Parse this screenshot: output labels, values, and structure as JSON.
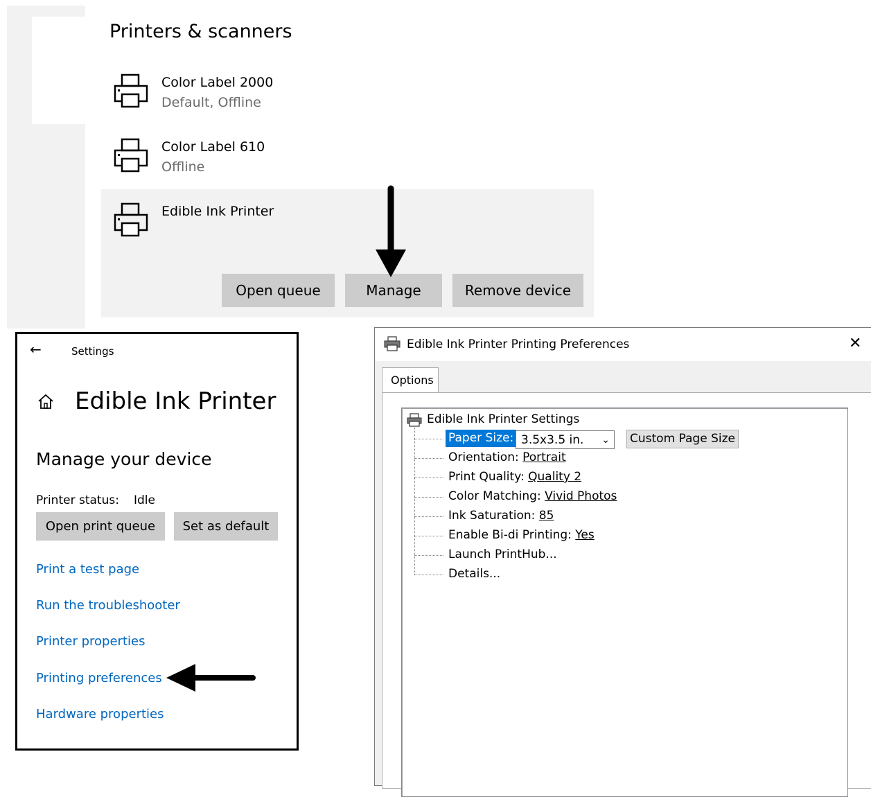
{
  "printers_panel": {
    "title": "Printers & scanners",
    "printers": [
      {
        "name": "Color Label 2000",
        "status": "Default, Offline"
      },
      {
        "name": "Color Label 610",
        "status": "Offline"
      },
      {
        "name": "Edible Ink Printer",
        "status": ""
      }
    ],
    "buttons": {
      "open_queue": "Open queue",
      "manage": "Manage",
      "remove_device": "Remove device"
    }
  },
  "settings_panel": {
    "nav_title": "Settings",
    "device_title": "Edible Ink Printer",
    "heading": "Manage your device",
    "status_label": "Printer status:",
    "status_value": "Idle",
    "buttons": {
      "open_print_queue": "Open print queue",
      "set_as_default": "Set as default"
    },
    "links": [
      "Print a test page",
      "Run the troubleshooter",
      "Printer properties",
      "Printing preferences",
      "Hardware properties"
    ]
  },
  "preferences_dialog": {
    "title": "Edible Ink Printer Printing Preferences",
    "close_glyph": "✕",
    "tab": "Options",
    "tree_root": "Edible Ink Printer Settings",
    "paper_size_label": "Paper Size:",
    "paper_size_value": "3.5x3.5 in.",
    "custom_page_size_button": "Custom Page Size",
    "items": [
      {
        "label": "Orientation: ",
        "value": "Portrait"
      },
      {
        "label": "Print Quality: ",
        "value": "Quality 2"
      },
      {
        "label": "Color Matching: ",
        "value": "Vivid Photos"
      },
      {
        "label": "Ink Saturation: ",
        "value": "85"
      },
      {
        "label": "Enable Bi-di Printing: ",
        "value": "Yes"
      },
      {
        "label": "Launch PrintHub...",
        "value": ""
      },
      {
        "label": "Details...",
        "value": ""
      }
    ]
  },
  "colors": {
    "link_blue": "#0067c0",
    "selection_blue": "#0078d7",
    "button_gray": "#cccccc"
  },
  "icons": [
    "printer-icon",
    "back-arrow-icon",
    "home-icon",
    "close-icon",
    "chevron-down-icon",
    "arrow-down-icon",
    "arrow-left-icon"
  ]
}
